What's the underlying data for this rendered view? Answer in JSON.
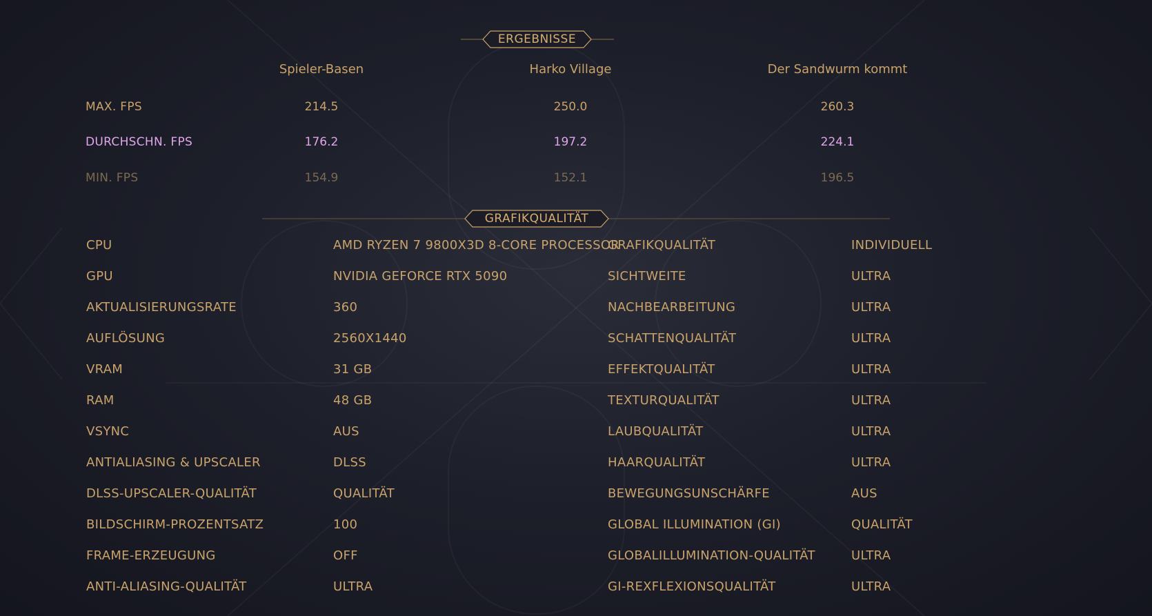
{
  "results": {
    "title": "ERGEBNISSE",
    "columns": [
      "Spieler-Basen",
      "Harko Village",
      "Der Sandwurm kommt"
    ],
    "rows": [
      {
        "label": "MAX. FPS",
        "values": [
          "214.5",
          "250.0",
          "260.3"
        ],
        "tone": "max"
      },
      {
        "label": "DURCHSCHN. FPS",
        "values": [
          "176.2",
          "197.2",
          "224.1"
        ],
        "tone": "avg"
      },
      {
        "label": "MIN. FPS",
        "values": [
          "154.9",
          "152.1",
          "196.5"
        ],
        "tone": "min"
      }
    ]
  },
  "graphics": {
    "title": "GRAFIKQUALITÄT",
    "left": [
      {
        "label": "CPU",
        "value": "AMD RYZEN 7 9800X3D 8-CORE PROCESSOR"
      },
      {
        "label": "GPU",
        "value": "NVIDIA GEFORCE RTX 5090"
      },
      {
        "label": "AKTUALISIERUNGSRATE",
        "value": "360"
      },
      {
        "label": "AUFLÖSUNG",
        "value": "2560X1440"
      },
      {
        "label": "VRAM",
        "value": "31 GB"
      },
      {
        "label": "RAM",
        "value": "48 GB"
      },
      {
        "label": "VSYNC",
        "value": "AUS"
      },
      {
        "label": "ANTIALIASING & UPSCALER",
        "value": "DLSS"
      },
      {
        "label": "DLSS-UPSCALER-QUALITÄT",
        "value": "QUALITÄT"
      },
      {
        "label": "BILDSCHIRM-PROZENTSATZ",
        "value": "100"
      },
      {
        "label": "FRAME-ERZEUGUNG",
        "value": "OFF"
      },
      {
        "label": "ANTI-ALIASING-QUALITÄT",
        "value": "ULTRA"
      }
    ],
    "right": [
      {
        "label": "GRAFIKQUALITÄT",
        "value": "INDIVIDUELL"
      },
      {
        "label": "SICHTWEITE",
        "value": "ULTRA"
      },
      {
        "label": "NACHBEARBEITUNG",
        "value": "ULTRA"
      },
      {
        "label": "SCHATTENQUALITÄT",
        "value": "ULTRA"
      },
      {
        "label": "EFFEKTQUALITÄT",
        "value": "ULTRA"
      },
      {
        "label": "TEXTURQUALITÄT",
        "value": "ULTRA"
      },
      {
        "label": "LAUBQUALITÄT",
        "value": "ULTRA"
      },
      {
        "label": "HAARQUALITÄT",
        "value": "ULTRA"
      },
      {
        "label": "BEWEGUNGSUNSCHÄRFE",
        "value": "AUS"
      },
      {
        "label": "GLOBAL ILLUMINATION (GI)",
        "value": "QUALITÄT"
      },
      {
        "label": "GLOBALILLUMINATION-QUALITÄT",
        "value": "ULTRA"
      },
      {
        "label": "GI-REXFLEXIONSQUALITÄT",
        "value": "ULTRA"
      }
    ]
  },
  "colors": {
    "gold": "#c9a36b",
    "average": "#e0a6e8",
    "minimum": "#7b6a52",
    "background": "#1d1f2a"
  }
}
